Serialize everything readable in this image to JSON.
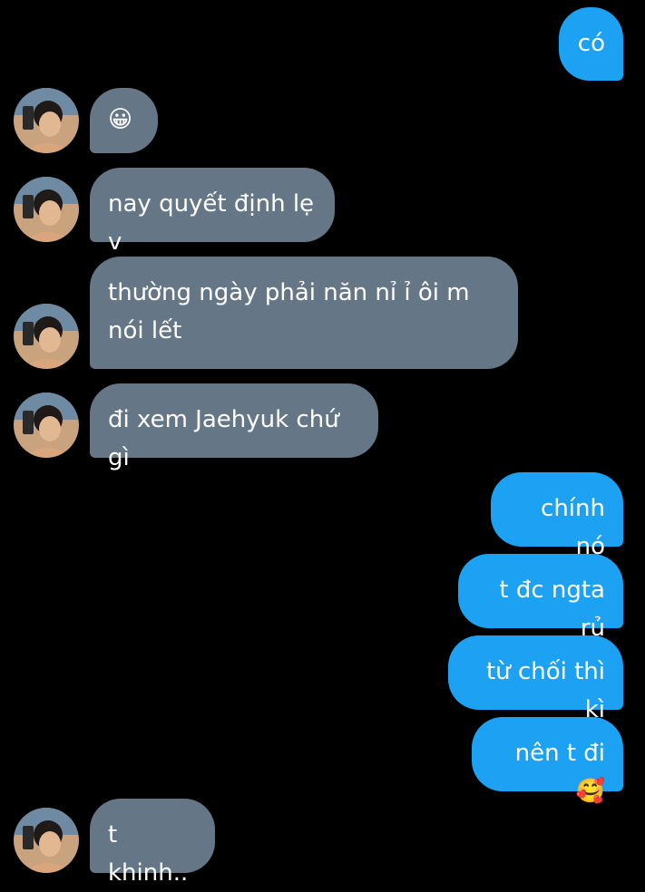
{
  "colors": {
    "background": "#000000",
    "sent_bubble": "#1da1f2",
    "received_bubble": "#657786",
    "text": "#ffffff"
  },
  "messages": [
    {
      "from": "me",
      "text": "có"
    },
    {
      "from": "them",
      "text": "😀"
    },
    {
      "from": "them",
      "text": "nay quyết định lẹ v"
    },
    {
      "from": "them",
      "text": "thường ngày phải năn nỉ ỉ ôi m nói lết"
    },
    {
      "from": "them",
      "text": "đi xem Jaehyuk chứ gì"
    },
    {
      "from": "me",
      "text": "chính nó"
    },
    {
      "from": "me",
      "text": "t đc ngta rủ"
    },
    {
      "from": "me",
      "text": "từ chối thì kì"
    },
    {
      "from": "me",
      "text": "nên t đi🥰"
    },
    {
      "from": "them",
      "text": "t khinh.."
    }
  ],
  "avatar_icon": "user-avatar-photo"
}
